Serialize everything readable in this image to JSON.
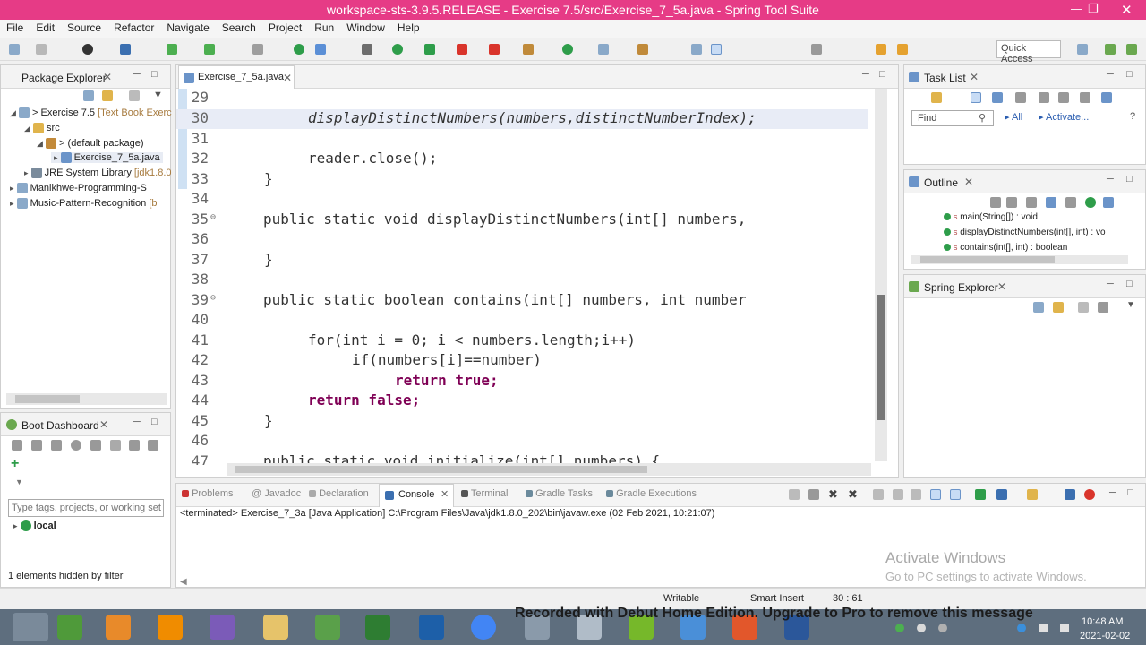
{
  "window": {
    "title": "workspace-sts-3.9.5.RELEASE - Exercise 7.5/src/Exercise_7_5a.java - Spring Tool Suite",
    "min_icon": "minimize-icon",
    "max_icon": "maximize-icon",
    "close_icon": "close-icon"
  },
  "menu": [
    "File",
    "Edit",
    "Source",
    "Refactor",
    "Navigate",
    "Search",
    "Project",
    "Run",
    "Window",
    "Help"
  ],
  "toolbar": {
    "quick_access": "Quick Access"
  },
  "package_explorer": {
    "tab": "Package Explorer",
    "items": [
      {
        "label": "> Exercise 7.5",
        "suffix": " [Text Book Exerc"
      },
      {
        "label": "src",
        "suffix": ""
      },
      {
        "label": "> (default package)",
        "suffix": ""
      },
      {
        "label": "Exercise_7_5a.java",
        "suffix": ""
      },
      {
        "label": "JRE System Library",
        "suffix": " [jdk1.8.0"
      },
      {
        "label": "Manikhwe-Programming-S",
        "suffix": ""
      },
      {
        "label": "Music-Pattern-Recognition",
        "suffix": " [b"
      }
    ]
  },
  "boot_dashboard": {
    "tab": "Boot Dashboard",
    "filter_placeholder": "Type tags, projects, or working set",
    "local": "local",
    "hidden": "1 elements hidden by filter"
  },
  "editor": {
    "tab": "Exercise_7_5a.java",
    "lines": [
      {
        "n": "29",
        "text": ""
      },
      {
        "n": "30",
        "text": "displayDistinctNumbers(numbers,distinctNumberIndex);"
      },
      {
        "n": "31",
        "text": ""
      },
      {
        "n": "32",
        "text": "reader.close();"
      },
      {
        "n": "33",
        "text": "}"
      },
      {
        "n": "34",
        "text": ""
      },
      {
        "n": "35",
        "text": "public static void displayDistinctNumbers(int[] numbers,"
      },
      {
        "n": "36",
        "text": ""
      },
      {
        "n": "37",
        "text": "}"
      },
      {
        "n": "38",
        "text": ""
      },
      {
        "n": "39",
        "text": "public static boolean contains(int[] numbers, int number"
      },
      {
        "n": "40",
        "text": ""
      },
      {
        "n": "41",
        "text": "for(int i = 0; i < numbers.length;i++)"
      },
      {
        "n": "42",
        "text": "if(numbers[i]==number)"
      },
      {
        "n": "43",
        "text": "return true;"
      },
      {
        "n": "44",
        "text": "return false;"
      },
      {
        "n": "45",
        "text": "}"
      },
      {
        "n": "46",
        "text": ""
      },
      {
        "n": "47",
        "text": "public static void initialize(int[] numbers) {"
      }
    ]
  },
  "task_list": {
    "tab": "Task List",
    "find": "Find",
    "all": "All",
    "activate": "Activate..."
  },
  "outline": {
    "tab": "Outline",
    "items": [
      {
        "name": "main(String[]) : void"
      },
      {
        "name": "displayDistinctNumbers(int[], int) : vo"
      },
      {
        "name": "contains(int[], int) : boolean"
      }
    ]
  },
  "spring_explorer": {
    "tab": "Spring Explorer"
  },
  "bottom": {
    "tabs": [
      "Problems",
      "Javadoc",
      "Declaration",
      "Console",
      "Terminal",
      "Gradle Tasks",
      "Gradle Executions"
    ],
    "active": "Console",
    "console_line": "<terminated> Exercise_7_3a [Java Application] C:\\Program Files\\Java\\jdk1.8.0_202\\bin\\javaw.exe (02 Feb 2021, 10:21:07)"
  },
  "watermark": {
    "line1": "Activate Windows",
    "line2": "Go to PC settings to activate Windows."
  },
  "status": {
    "writable": "Writable",
    "insert": "Smart Insert",
    "pos": "30 : 61"
  },
  "recorder_note": "Recorded with Debut Home Edition. Upgrade to Pro to remove this message",
  "clock": {
    "time": "10:48 AM",
    "date": "2021-02-02"
  },
  "colors": {
    "titlebar": "#e63b86",
    "keyword": "#7f0055",
    "field": "#0000c0",
    "taskbar": "#5e6e7e"
  }
}
